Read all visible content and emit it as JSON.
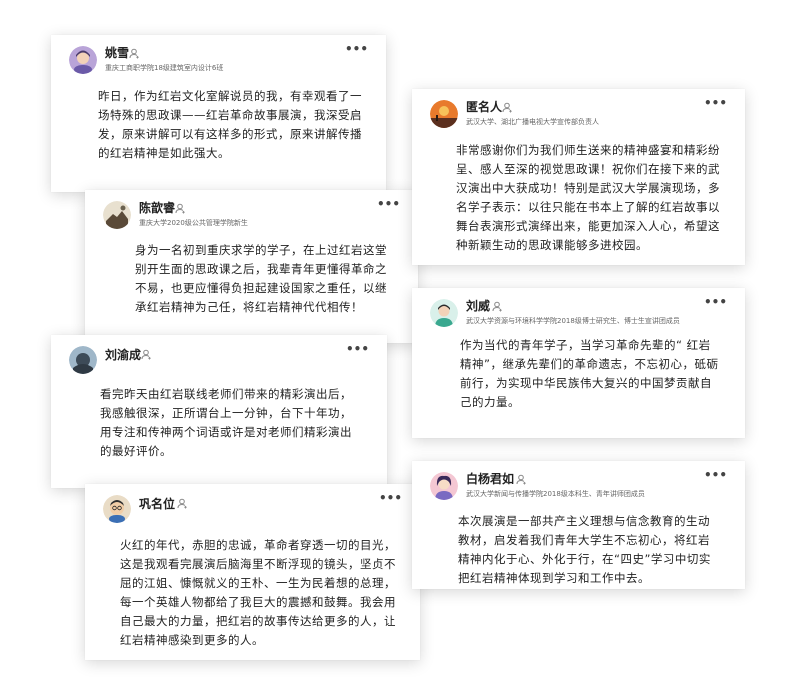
{
  "comments": [
    {
      "id": "yaoxue",
      "name": "姚雪",
      "subtitle": "重庆工商职学院18级建筑室内设计6班",
      "text": "昨日，作为红岩文化室解说员的我，有幸观看了一场特殊的思政课——红岩革命故事展演，我深受启发，原来讲解可以有这样多的形式，原来讲解传播的红岩精神是如此强大。",
      "more": "•••"
    },
    {
      "id": "chenxinrui",
      "name": "陈歆睿",
      "subtitle": "重庆大学2020级公共管理学院新生",
      "text": "身为一名初到重庆求学的学子，在上过红岩这堂别开生面的思政课之后，我辈青年更懂得革命之不易，也更应懂得负担起建设国家之重任，以继承红岩精神为己任，将红岩精神代代相传！",
      "more": "•••"
    },
    {
      "id": "liuyucheng",
      "name": "刘渝成",
      "subtitle": "",
      "text": "看完昨天由红岩联线老师们带来的精彩演出后，我感触很深，正所谓台上一分钟，台下十年功，用专注和传神两个词语或许是对老师们精彩演出的最好评价。",
      "more": "•••"
    },
    {
      "id": "gongmingwei",
      "name": "巩名位",
      "subtitle": "",
      "text": "火红的年代，赤胆的忠诚，革命者穿透一切的目光，这是我观看完展演后脑海里不断浮现的镜头，坚贞不屈的江姐、慷慨就义的王朴、一生为民着想的总理，每一个英雄人物都给了我巨大的震撼和鼓舞。我会用自己最大的力量，把红岩的故事传达给更多的人，让红岩精神感染到更多的人。",
      "more": "•••"
    },
    {
      "id": "niming",
      "name": "匿名人",
      "subtitle": "武汉大学、湖北广播电视大学宣传部负责人",
      "text": "非常感谢你们为我们师生送来的精神盛宴和精彩纷呈、感人至深的视觉思政课！祝你们在接下来的武汉演出中大获成功！特别是武汉大学展演现场，多名学子表示：以往只能在书本上了解的红岩故事以舞台表演形式演绎出来，能更加深入人心，希望这种新颖生动的思政课能够多进校园。",
      "more": "•••"
    },
    {
      "id": "liuwei",
      "name": "刘威",
      "subtitle": "武汉大学资源与环境科学学院2018级博士研究生、博士生宣讲团成员",
      "text": "作为当代的青年学子，当学习革命先辈的“ 红岩精神”，继承先辈们的革命遗志，不忘初心，砥砺前行，为实现中华民族伟大复兴的中国梦贡献自己的力量。",
      "more": "•••"
    },
    {
      "id": "baiyangjunru",
      "name": "白杨君如",
      "subtitle": "武汉大学新闻与传播学院2018级本科生、青年讲师团成员",
      "text": "本次展演是一部共产主义理想与信念教育的生动教材，启发着我们青年大学生不忘初心，将红岩精神内化于心、外化于行，在“四史”学习中切实把红岩精神体现到学习和工作中去。",
      "more": "•••"
    }
  ],
  "icons": {
    "follow": "user-follow-icon",
    "more": "more-dots-icon"
  },
  "colors": {
    "accent_red": "#d94b3a",
    "text": "#222222",
    "subtext": "#666666"
  }
}
